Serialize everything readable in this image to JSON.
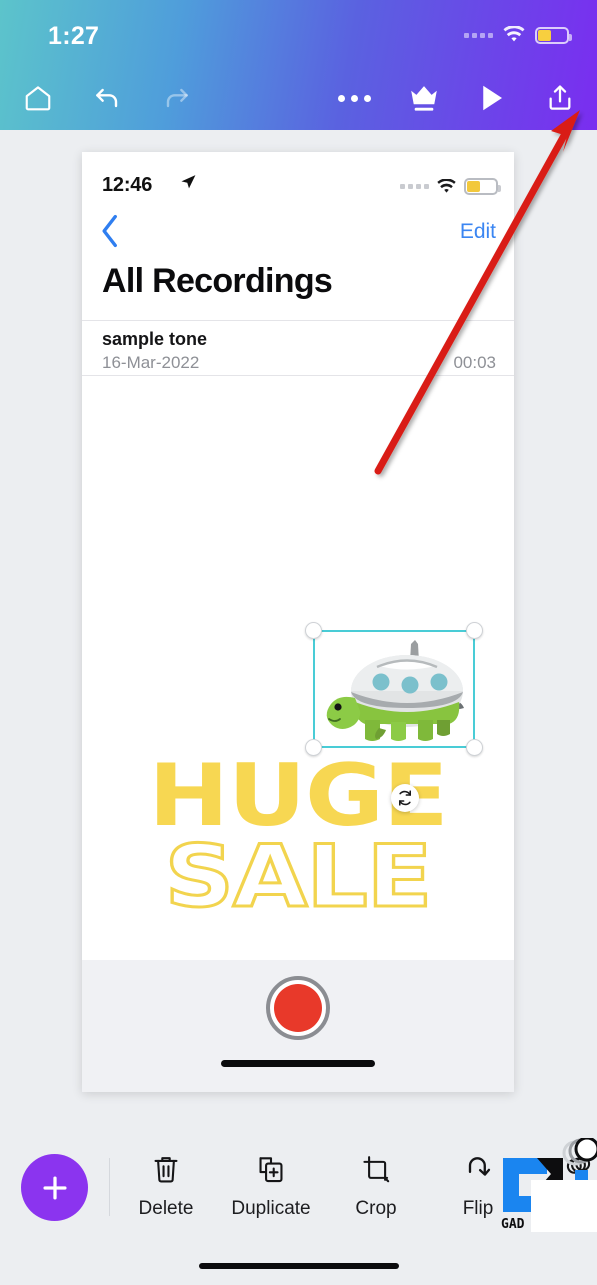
{
  "app": {
    "name": "Canva Mobile Editor",
    "accent_purple": "#8b34ef",
    "gradient_start": "#5cc4cb",
    "gradient_end": "#7a2df0",
    "canvas_bg": "#eceef1"
  },
  "status_bar": {
    "time": "1:27",
    "signal_icon": "cellular-signal-icon",
    "wifi_icon": "wifi-icon",
    "battery_icon": "battery-icon",
    "battery_color": "#f7cf3f"
  },
  "toolbar": {
    "home_icon": "home-icon",
    "undo_icon": "undo-icon",
    "redo_icon": "redo-icon",
    "more_icon": "more-options-icon",
    "crown_icon": "crown-premium-icon",
    "play_icon": "play-preview-icon",
    "share_icon": "share-export-icon"
  },
  "annotation": {
    "arrow_icon": "red-arrow-pointer",
    "arrow_color": "#d91f17",
    "points_to": "share-export-icon"
  },
  "canvas": {
    "selected_element": {
      "name": "turtle-ufo-sticker",
      "selection_color": "#49ccd6",
      "rotate_icon": "rotate-icon",
      "handles": [
        "top-left",
        "top-right",
        "bottom-left",
        "bottom-right"
      ]
    },
    "headline_filled": "HUGE",
    "headline_outlined": "SALE",
    "headline_color": "#f7d752",
    "screenshot_image": {
      "status_bar": {
        "time": "12:46",
        "location_icon": "location-arrow-icon",
        "signal_icon": "cellular-signal-icon",
        "wifi_icon": "wifi-icon",
        "battery_icon": "battery-icon"
      },
      "nav": {
        "back_icon": "chevron-left-icon",
        "edit_label": "Edit"
      },
      "title": "All Recordings",
      "recordings": [
        {
          "name": "sample tone",
          "date": "16-Mar-2022",
          "duration": "00:03"
        }
      ],
      "record_button_icon": "record-button-icon",
      "record_button_color": "#e8392a",
      "home_indicator": "home-indicator"
    }
  },
  "bottom_toolbar": {
    "add_button": {
      "icon": "plus-icon",
      "label": "+",
      "color": "#8b34ef"
    },
    "items": [
      {
        "label": "Delete",
        "icon": "trash-icon"
      },
      {
        "label": "Duplicate",
        "icon": "duplicate-icon"
      },
      {
        "label": "Crop",
        "icon": "crop-icon"
      },
      {
        "label": "Flip",
        "icon": "flip-icon"
      },
      {
        "label": "",
        "icon": "layers-icon"
      }
    ],
    "home_indicator": "home-indicator"
  },
  "watermark": {
    "brand": "GAD",
    "icon": "gadgets-logo-watermark"
  }
}
